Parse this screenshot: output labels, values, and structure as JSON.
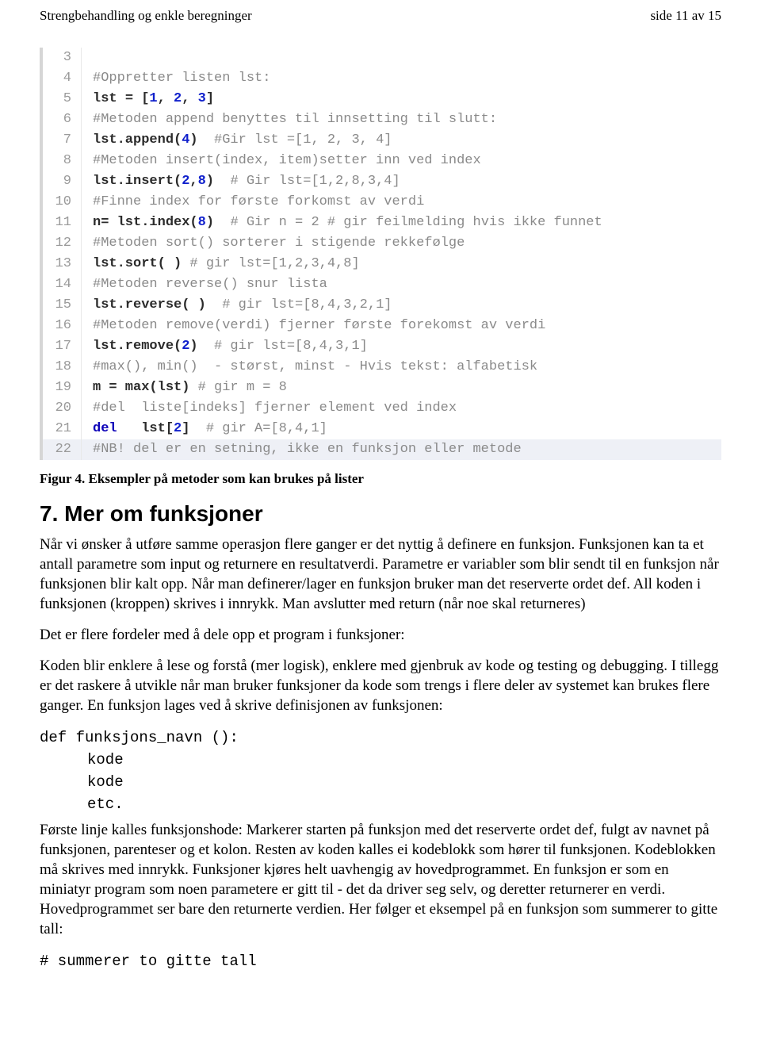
{
  "header": {
    "left": "Strengbehandling og enkle beregninger",
    "right": "side 11 av 15"
  },
  "code": {
    "lines": [
      {
        "n": "3",
        "hl": false,
        "segments": []
      },
      {
        "n": "4",
        "hl": false,
        "segments": [
          {
            "cls": "t-grey",
            "txt": "#Oppretter listen lst:"
          }
        ]
      },
      {
        "n": "5",
        "hl": false,
        "segments": [
          {
            "cls": "t-black",
            "txt": "lst "
          },
          {
            "cls": "t-black",
            "txt": "= ["
          },
          {
            "cls": "t-blue",
            "txt": "1"
          },
          {
            "cls": "t-black",
            "txt": ", "
          },
          {
            "cls": "t-blue",
            "txt": "2"
          },
          {
            "cls": "t-black",
            "txt": ", "
          },
          {
            "cls": "t-blue",
            "txt": "3"
          },
          {
            "cls": "t-black",
            "txt": "]"
          }
        ]
      },
      {
        "n": "6",
        "hl": false,
        "segments": [
          {
            "cls": "t-grey",
            "txt": "#Metoden append benyttes til innsetting til slutt:"
          }
        ]
      },
      {
        "n": "7",
        "hl": false,
        "segments": [
          {
            "cls": "t-black",
            "txt": "lst.append("
          },
          {
            "cls": "t-blue",
            "txt": "4"
          },
          {
            "cls": "t-black",
            "txt": ")  "
          },
          {
            "cls": "t-grey",
            "txt": "#Gir lst =[1, 2, 3, 4]"
          }
        ]
      },
      {
        "n": "8",
        "hl": false,
        "segments": [
          {
            "cls": "t-grey",
            "txt": "#Metoden insert(index, item)setter inn ved index"
          }
        ]
      },
      {
        "n": "9",
        "hl": false,
        "segments": [
          {
            "cls": "t-black",
            "txt": "lst.insert("
          },
          {
            "cls": "t-blue",
            "txt": "2"
          },
          {
            "cls": "t-black",
            "txt": ","
          },
          {
            "cls": "t-blue",
            "txt": "8"
          },
          {
            "cls": "t-black",
            "txt": ")  "
          },
          {
            "cls": "t-grey",
            "txt": "# Gir lst=[1,2,8,3,4]"
          }
        ]
      },
      {
        "n": "10",
        "hl": false,
        "segments": [
          {
            "cls": "t-grey",
            "txt": "#Finne index for første forkomst av verdi"
          }
        ]
      },
      {
        "n": "11",
        "hl": false,
        "segments": [
          {
            "cls": "t-black",
            "txt": "n= lst.index("
          },
          {
            "cls": "t-blue",
            "txt": "8"
          },
          {
            "cls": "t-black",
            "txt": ")  "
          },
          {
            "cls": "t-grey",
            "txt": "# Gir n = 2 # gir feilmelding hvis ikke funnet"
          }
        ]
      },
      {
        "n": "12",
        "hl": false,
        "segments": [
          {
            "cls": "t-grey",
            "txt": "#Metoden sort() sorterer i stigende rekkefølge"
          }
        ]
      },
      {
        "n": "13",
        "hl": false,
        "segments": [
          {
            "cls": "t-black",
            "txt": "lst.sort( ) "
          },
          {
            "cls": "t-grey",
            "txt": "# gir lst=[1,2,3,4,8]"
          }
        ]
      },
      {
        "n": "14",
        "hl": false,
        "segments": [
          {
            "cls": "t-grey",
            "txt": "#Metoden reverse() snur lista"
          }
        ]
      },
      {
        "n": "15",
        "hl": false,
        "segments": [
          {
            "cls": "t-black",
            "txt": "lst.reverse( )  "
          },
          {
            "cls": "t-grey",
            "txt": "# gir lst=[8,4,3,2,1]"
          }
        ]
      },
      {
        "n": "16",
        "hl": false,
        "segments": [
          {
            "cls": "t-grey",
            "txt": "#Metoden remove(verdi) fjerner første forekomst av verdi"
          }
        ]
      },
      {
        "n": "17",
        "hl": false,
        "segments": [
          {
            "cls": "t-black",
            "txt": "lst.remove("
          },
          {
            "cls": "t-blue",
            "txt": "2"
          },
          {
            "cls": "t-black",
            "txt": ")  "
          },
          {
            "cls": "t-grey",
            "txt": "# gir lst=[8,4,3,1]"
          }
        ]
      },
      {
        "n": "18",
        "hl": false,
        "segments": [
          {
            "cls": "t-grey",
            "txt": "#max(), min()  - størst, minst - Hvis tekst: alfabetisk"
          }
        ]
      },
      {
        "n": "19",
        "hl": false,
        "segments": [
          {
            "cls": "t-black",
            "txt": "m = max(lst) "
          },
          {
            "cls": "t-grey",
            "txt": "# gir m = 8"
          }
        ]
      },
      {
        "n": "20",
        "hl": false,
        "segments": [
          {
            "cls": "t-grey",
            "txt": "#del  liste[indeks] fjerner element ved index"
          }
        ]
      },
      {
        "n": "21",
        "hl": false,
        "segments": [
          {
            "cls": "t-kw",
            "txt": "del"
          },
          {
            "cls": "t-black",
            "txt": "   lst["
          },
          {
            "cls": "t-blue",
            "txt": "2"
          },
          {
            "cls": "t-black",
            "txt": "]  "
          },
          {
            "cls": "t-grey",
            "txt": "# gir A=[8,4,1]"
          }
        ]
      },
      {
        "n": "22",
        "hl": true,
        "segments": [
          {
            "cls": "t-grey",
            "txt": "#NB! del er en setning, ikke en funksjon eller metode"
          }
        ]
      }
    ]
  },
  "figcaption": "Figur 4. Eksempler på metoder som kan brukes på lister",
  "section_title": "7. Mer om funksjoner",
  "para1": "Når vi ønsker å utføre samme operasjon flere ganger er det nyttig å definere en funksjon. Funksjonen kan ta et antall parametre som input og returnere en resultatverdi. Parametre er variabler som blir sendt til en funksjon når funksjonen blir kalt opp. Når man definerer/lager en funksjon bruker man det reserverte ordet def. All koden i funksjonen (kroppen) skrives i innrykk.  Man avslutter med return (når noe skal returneres)",
  "para2": "Det er flere fordeler med å dele opp et program i funksjoner:",
  "para3": "Koden blir enklere å lese og forstå (mer logisk), enklere med gjenbruk av kode og testing og debugging. I tillegg er det raskere å utvikle når man bruker funksjoner da kode som trengs i flere deler av systemet kan brukes flere ganger. En funksjon lages ved å skrive definisjonen av funksjonen:",
  "codeinline": {
    "l1": "def funksjons_navn ():",
    "l2": "kode",
    "l3": "kode",
    "l4": "etc."
  },
  "para4": "Første linje kalles funksjonshode: Markerer starten på funksjon med det reserverte ordet def, fulgt av navnet på funksjonen, parenteser og et kolon. Resten av koden kalles ei kodeblokk som hører til funksjonen. Kodeblokken må skrives med innrykk.  Funksjoner kjøres helt uavhengig av hovedprogrammet. En funksjon er som en miniatyr program som noen parametere er gitt til - det da driver seg selv, og deretter returnerer en verdi. Hovedprogrammet ser bare den returnerte verdien. Her følger et eksempel på en funksjon som summerer to gitte tall:",
  "codeinline2": "# summerer to gitte tall"
}
